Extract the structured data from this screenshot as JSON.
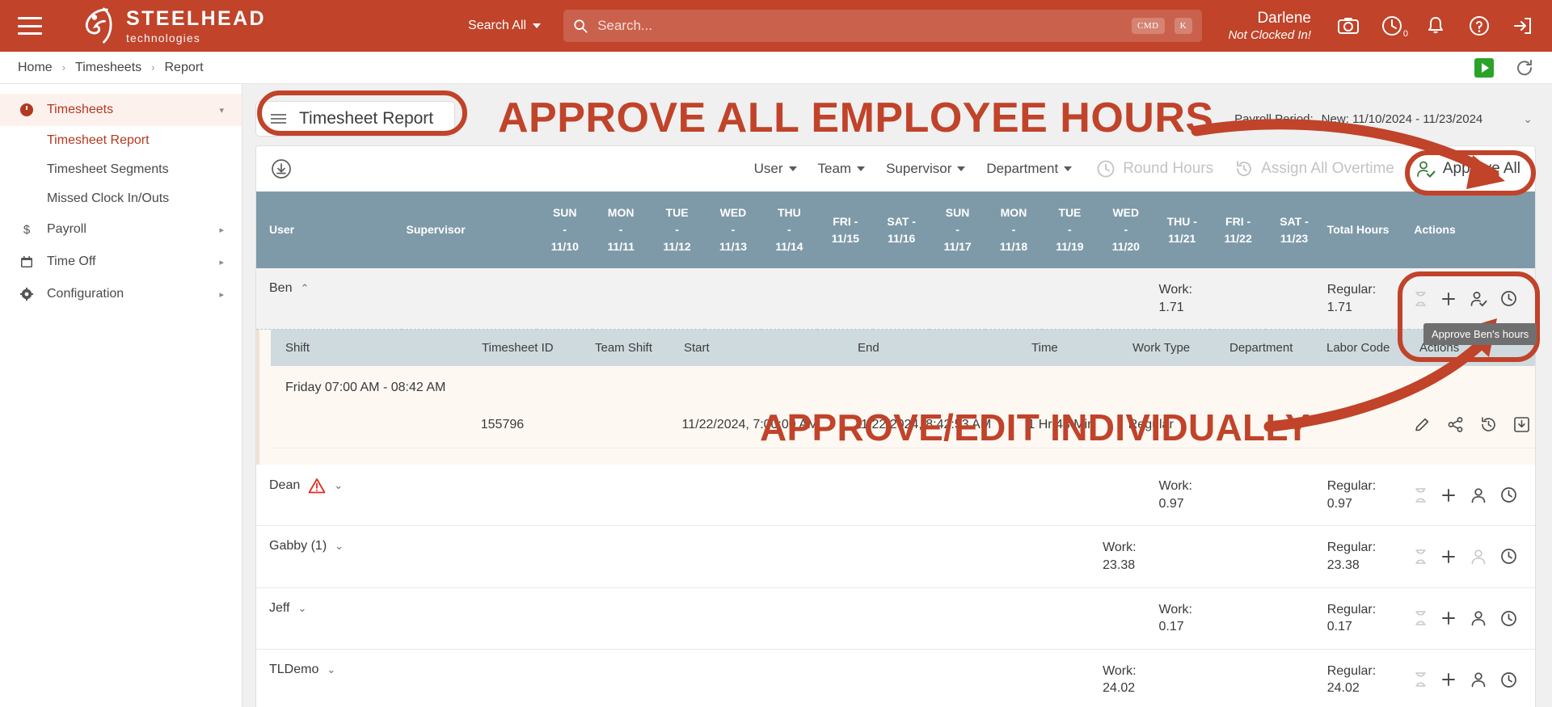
{
  "topbar": {
    "menu_icon": "hamburger-icon",
    "brand": {
      "title": "STEELHEAD",
      "subtitle": "technologies"
    },
    "search_scope": "Search All",
    "search": {
      "placeholder": "Search...",
      "value": "",
      "kbd1": "CMD",
      "kbd2": "K"
    },
    "user": {
      "name": "Darlene",
      "status": "Not Clocked In!"
    },
    "icons": [
      "camera-icon",
      "history-icon",
      "bell-icon",
      "help-icon",
      "logout-icon"
    ],
    "history_badge": "0",
    "bg_color": "#c0432a"
  },
  "breadcrumb": {
    "items": [
      "Home",
      "Timesheets",
      "Report"
    ],
    "separator": "›"
  },
  "crumb_actions": {
    "play": "play-icon",
    "refresh": "refresh-icon"
  },
  "sidebar": {
    "groups": [
      {
        "label": "Timesheets",
        "icon": "clock-icon",
        "active": true,
        "caret": "▾",
        "children": [
          {
            "label": "Timesheet Report",
            "selected": true
          },
          {
            "label": "Timesheet Segments",
            "selected": false
          },
          {
            "label": "Missed Clock In/Outs",
            "selected": false
          }
        ]
      },
      {
        "label": "Payroll",
        "icon": "dollar-icon",
        "active": false,
        "caret": "▸",
        "children": []
      },
      {
        "label": "Time Off",
        "icon": "calendar-icon",
        "active": false,
        "caret": "▸",
        "children": []
      },
      {
        "label": "Configuration",
        "icon": "gear-icon",
        "active": false,
        "caret": "▸",
        "children": []
      }
    ]
  },
  "page": {
    "report_title": "Timesheet Report",
    "payroll_label": "Payroll Period:",
    "payroll_value": "New: 11/10/2024 - 11/23/2024",
    "payroll_caret": "⌄"
  },
  "annotations": {
    "banner_top": "APPROVE ALL EMPLOYEE HOURS",
    "banner_mid": "APPROVE/EDIT INDIVIDUALLY",
    "color": "#c0432a"
  },
  "toolbar": {
    "download_icon": "download-icon",
    "filters": [
      {
        "label": "User"
      },
      {
        "label": "Team"
      },
      {
        "label": "Supervisor"
      },
      {
        "label": "Department"
      }
    ],
    "actions": [
      {
        "label": "Round Hours",
        "icon": "clock-icon",
        "enabled": false
      },
      {
        "label": "Assign All Overtime",
        "icon": "refresh-clock-icon",
        "enabled": false
      },
      {
        "label": "Approve All",
        "icon": "person-check-icon",
        "enabled": true
      }
    ]
  },
  "table": {
    "headers": {
      "user": "User",
      "supervisor": "Supervisor",
      "days": [
        {
          "dow": "SUN",
          "dash": "-",
          "date": "11/10"
        },
        {
          "dow": "MON",
          "dash": "-",
          "date": "11/11"
        },
        {
          "dow": "TUE",
          "dash": "-",
          "date": "11/12"
        },
        {
          "dow": "WED",
          "dash": "-",
          "date": "11/13"
        },
        {
          "dow": "THU",
          "dash": "-",
          "date": "11/14"
        },
        {
          "dow": "FRI -",
          "dash": "",
          "date": "11/15"
        },
        {
          "dow": "SAT -",
          "dash": "",
          "date": "11/16"
        },
        {
          "dow": "SUN",
          "dash": "-",
          "date": "11/17"
        },
        {
          "dow": "MON",
          "dash": "-",
          "date": "11/18"
        },
        {
          "dow": "TUE",
          "dash": "-",
          "date": "11/19"
        },
        {
          "dow": "WED",
          "dash": "-",
          "date": "11/20"
        },
        {
          "dow": "THU -",
          "dash": "",
          "date": "11/21"
        },
        {
          "dow": "FRI -",
          "dash": "",
          "date": "11/22"
        },
        {
          "dow": "SAT -",
          "dash": "",
          "date": "11/23"
        }
      ],
      "total_hours": "Total Hours",
      "actions": "Actions"
    },
    "rows": [
      {
        "user": "Ben",
        "expanded": true,
        "chev": "⌃",
        "warn": false,
        "work_label": "Work:",
        "work_value": "1.71",
        "reg_label": "Regular:",
        "reg_value": "1.71",
        "work_col": 12,
        "reg_col": 13
      },
      {
        "user": "Dean",
        "expanded": false,
        "chev": "⌄",
        "warn": true,
        "work_label": "Work:",
        "work_value": "0.97",
        "reg_label": "Regular:",
        "reg_value": "0.97",
        "work_col": 12,
        "reg_col": 13
      },
      {
        "user": "Gabby (1)",
        "expanded": false,
        "chev": "⌄",
        "warn": false,
        "work_label": "Work:",
        "work_value": "23.38",
        "reg_label": "Regular:",
        "reg_value": "23.38",
        "work_col": 11,
        "reg_col": 13
      },
      {
        "user": "Jeff",
        "expanded": false,
        "chev": "⌄",
        "warn": false,
        "work_label": "Work:",
        "work_value": "0.17",
        "reg_label": "Regular:",
        "reg_value": "0.17",
        "work_col": 12,
        "reg_col": 13
      },
      {
        "user": "TLDemo",
        "expanded": false,
        "chev": "⌄",
        "warn": false,
        "work_label": "Work:",
        "work_value": "24.02",
        "reg_label": "Regular:",
        "reg_value": "24.02",
        "work_col": 11,
        "reg_col": 13
      }
    ],
    "row_action_icons": [
      "hourglass-icon",
      "plus-icon",
      "person-icon",
      "clock-icon"
    ],
    "tooltip": "Approve Ben's hours"
  },
  "shift_table": {
    "headers": [
      "Shift",
      "Timesheet ID",
      "Team Shift",
      "Start",
      "End",
      "Time",
      "Work Type",
      "Department",
      "Labor Code",
      "Actions"
    ],
    "shift_title": "Friday 07:00 AM - 08:42 AM",
    "row": {
      "timesheet_id": "155796",
      "team_shift": "",
      "start": "11/22/2024, 7:00:00 AM",
      "end": "11/22/2024, 8:42:53 AM",
      "time": "1 Hr 43 Min",
      "work_type": "Regular",
      "department": "",
      "labor_code": ""
    },
    "row_action_icons": [
      "pencil-icon",
      "share-icon",
      "history-icon",
      "download-box-icon"
    ]
  }
}
